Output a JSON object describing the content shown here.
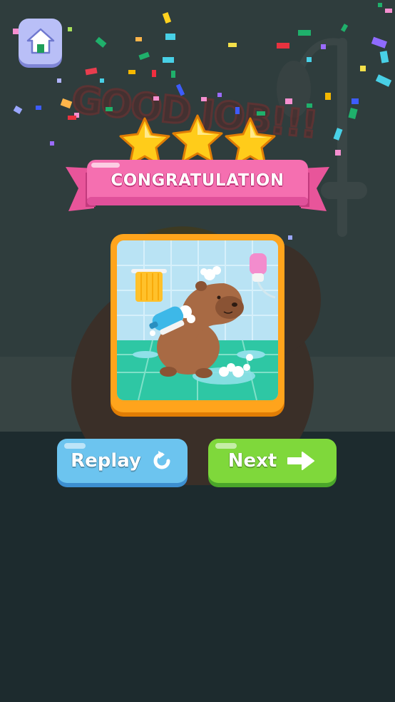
{
  "scene": {
    "background_text": "GOOD JOB!!!",
    "banner_title": "CONGRATULATION",
    "stars_earned": 3,
    "stars_total": 3
  },
  "buttons": {
    "home_icon": "home-icon",
    "replay_label": "Replay",
    "replay_icon": "restart-icon",
    "next_label": "Next",
    "next_icon": "arrow-right-icon"
  },
  "colors": {
    "banner": "#f56fb0",
    "card_frame": "#ffa41c",
    "replay_button": "#6cc4ef",
    "next_button": "#7fd83b",
    "home_button": "#b9bff7",
    "star": "#ffcc1a"
  }
}
